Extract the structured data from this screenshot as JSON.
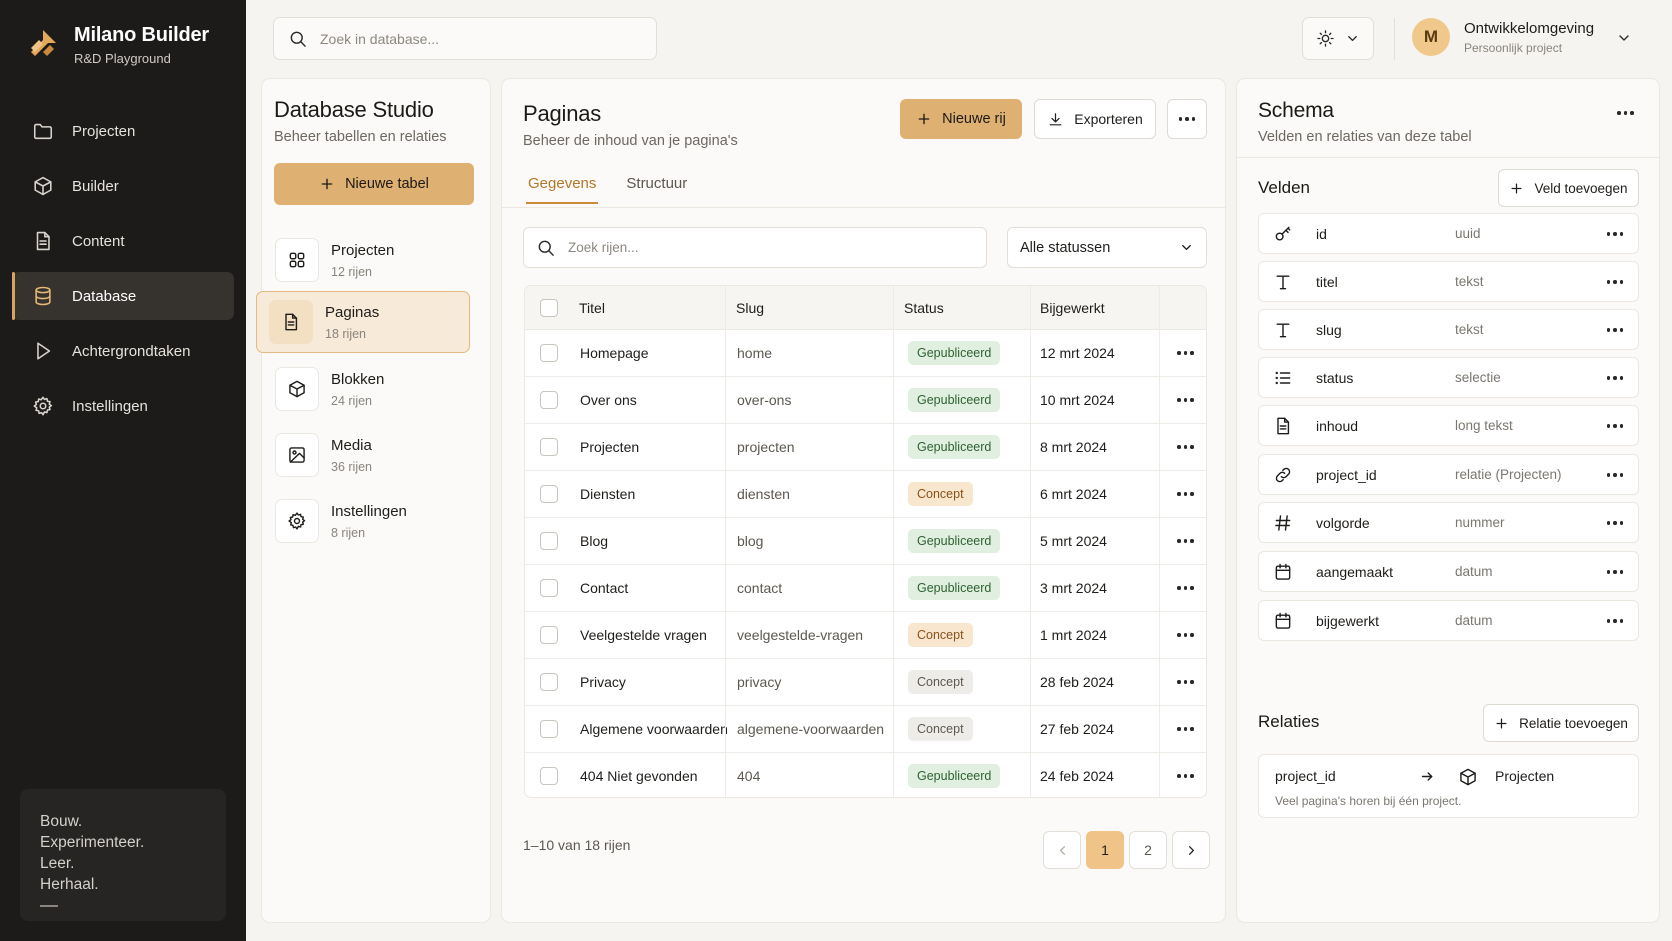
{
  "brand": {
    "name": "Milano Builder",
    "subtitle": "R&D Playground"
  },
  "nav": [
    {
      "label": "Projecten",
      "icon": "folder-icon"
    },
    {
      "label": "Builder",
      "icon": "cube-icon"
    },
    {
      "label": "Content",
      "icon": "document-icon"
    },
    {
      "label": "Database",
      "icon": "database-icon",
      "active": true
    },
    {
      "label": "Achtergrondtaken",
      "icon": "play-icon"
    },
    {
      "label": "Instellingen",
      "icon": "gear-icon"
    }
  ],
  "motto": {
    "lines": [
      "Bouw.",
      "Experimenteer.",
      "Leer.",
      "Herhaal."
    ]
  },
  "topbar": {
    "search_placeholder": "Zoek in database...",
    "user": {
      "initial": "M",
      "name": "Ontwikkelomgeving",
      "subtitle": "Persoonlijk project"
    }
  },
  "studio": {
    "title": "Database Studio",
    "subtitle": "Beheer tabellen en relaties",
    "new_table_label": "Nieuwe tabel",
    "tables": [
      {
        "name": "Projecten",
        "count": "12 rijen",
        "icon": "grid-icon"
      },
      {
        "name": "Paginas",
        "count": "18 rijen",
        "icon": "document-icon",
        "active": true
      },
      {
        "name": "Blokken",
        "count": "24 rijen",
        "icon": "cube-icon"
      },
      {
        "name": "Media",
        "count": "36 rijen",
        "icon": "image-icon"
      },
      {
        "name": "Instellingen",
        "count": "8 rijen",
        "icon": "gear-icon"
      }
    ]
  },
  "main": {
    "title": "Paginas",
    "subtitle": "Beheer de inhoud van je pagina's",
    "new_row_label": "Nieuwe rij",
    "export_label": "Exporteren",
    "tabs": [
      {
        "label": "Gegevens",
        "active": true
      },
      {
        "label": "Structuur"
      }
    ],
    "row_search_placeholder": "Zoek rijen...",
    "status_filter": "Alle statussen",
    "columns": [
      "Titel",
      "Slug",
      "Status",
      "Bijgewerkt"
    ],
    "rows": [
      {
        "title": "Homepage",
        "slug": "home",
        "status": "Gepubliceerd",
        "status_kind": "published",
        "updated": "12 mrt 2024"
      },
      {
        "title": "Over ons",
        "slug": "over-ons",
        "status": "Gepubliceerd",
        "status_kind": "published",
        "updated": "10 mrt 2024"
      },
      {
        "title": "Projecten",
        "slug": "projecten",
        "status": "Gepubliceerd",
        "status_kind": "published",
        "updated": "8 mrt 2024"
      },
      {
        "title": "Diensten",
        "slug": "diensten",
        "status": "Concept",
        "status_kind": "concept",
        "updated": "6 mrt 2024"
      },
      {
        "title": "Blog",
        "slug": "blog",
        "status": "Gepubliceerd",
        "status_kind": "published",
        "updated": "5 mrt 2024"
      },
      {
        "title": "Contact",
        "slug": "contact",
        "status": "Gepubliceerd",
        "status_kind": "published",
        "updated": "3 mrt 2024"
      },
      {
        "title": "Veelgestelde vragen",
        "slug": "veelgestelde-vragen",
        "status": "Concept",
        "status_kind": "concept",
        "updated": "1 mrt 2024"
      },
      {
        "title": "Privacy",
        "slug": "privacy",
        "status": "Concept",
        "status_kind": "draft-grey",
        "updated": "28 feb 2024"
      },
      {
        "title": "Algemene voorwaarden",
        "slug": "algemene-voorwaarden",
        "status": "Concept",
        "status_kind": "draft-grey",
        "updated": "27 feb 2024"
      },
      {
        "title": "404 Niet gevonden",
        "slug": "404",
        "status": "Gepubliceerd",
        "status_kind": "published",
        "updated": "24 feb 2024"
      }
    ],
    "pagination": {
      "info": "1–10 van 18 rijen",
      "pages": [
        "1",
        "2"
      ],
      "current": "1"
    }
  },
  "schema": {
    "title": "Schema",
    "subtitle": "Velden en relaties van deze tabel",
    "fields_title": "Velden",
    "add_field_label": "Veld toevoegen",
    "fields": [
      {
        "name": "id",
        "type": "uuid",
        "icon": "key-icon"
      },
      {
        "name": "titel",
        "type": "tekst",
        "icon": "text-icon"
      },
      {
        "name": "slug",
        "type": "tekst",
        "icon": "text-icon"
      },
      {
        "name": "status",
        "type": "selectie",
        "icon": "list-icon"
      },
      {
        "name": "inhoud",
        "type": "long tekst",
        "icon": "document-icon"
      },
      {
        "name": "project_id",
        "type": "relatie (Projecten)",
        "icon": "link-icon"
      },
      {
        "name": "volgorde",
        "type": "nummer",
        "icon": "hash-icon"
      },
      {
        "name": "aangemaakt",
        "type": "datum",
        "icon": "calendar-icon"
      },
      {
        "name": "bijgewerkt",
        "type": "datum",
        "icon": "calendar-icon"
      }
    ],
    "relations_title": "Relaties",
    "add_relation_label": "Relatie toevoegen",
    "relation": {
      "field": "project_id",
      "target": "Projecten",
      "description": "Veel pagina's horen bij één project."
    }
  },
  "colors": {
    "accent": "#deb072",
    "sidebar": "#1c1b1a",
    "published": "#e1efe0",
    "concept": "#f8e6cf"
  }
}
